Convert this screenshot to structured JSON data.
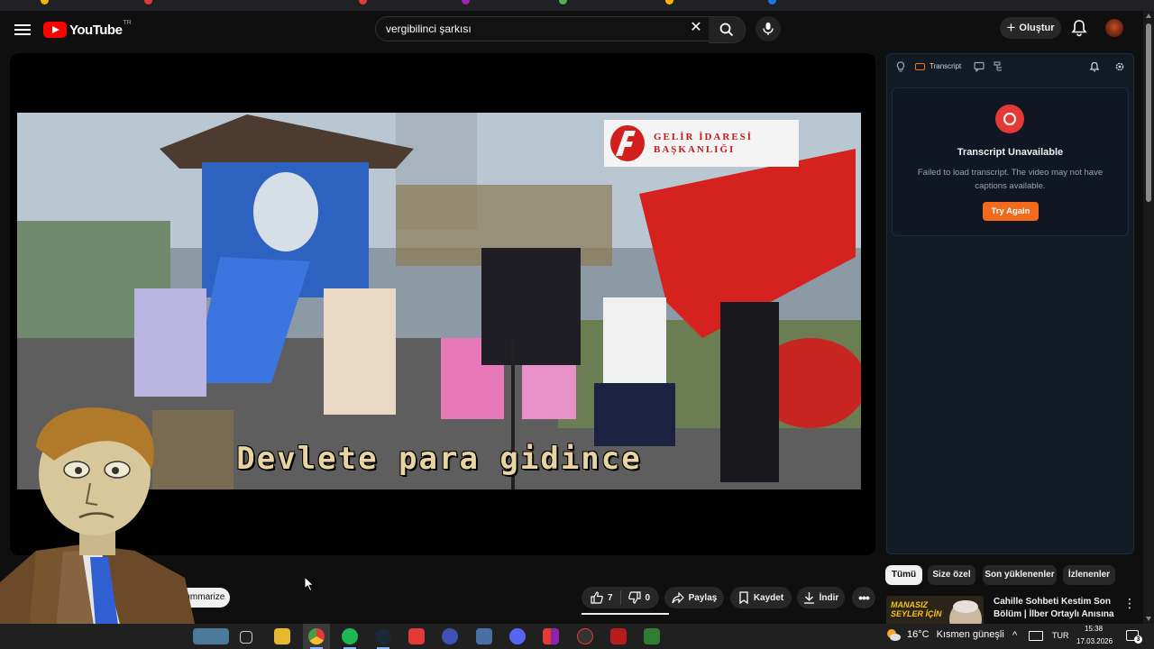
{
  "app": {
    "name": "YouTube",
    "country_code": "TR"
  },
  "search": {
    "value": "vergibilinci şarkısı"
  },
  "header": {
    "create_label": "Oluştur"
  },
  "player": {
    "caption": "Devlete para gidince",
    "watermark_line1": "GELİR İDARESİ",
    "watermark_line2": "BAŞKANLIĞI"
  },
  "panel": {
    "tab_label": "Transcript",
    "error_title": "Transcript Unavailable",
    "error_message": "Failed to load transcript. The video may not have captions available.",
    "retry_label": "Try Again"
  },
  "chips": [
    {
      "label": "Tümü",
      "active": true
    },
    {
      "label": "Size özel",
      "active": false
    },
    {
      "label": "Son yüklenenler",
      "active": false
    },
    {
      "label": "İzlenenler",
      "active": false
    }
  ],
  "recommendation": {
    "title": "Cahille Sohbeti Kestim Son Bölüm | İlber Ortaylı Anısına",
    "thumb_text": "MANASIZ SEYLER İÇİN"
  },
  "actions": {
    "like_count": "7",
    "dislike_count": "0",
    "share_label": "Paylaş",
    "save_label": "Kaydet",
    "download_label": "İndir",
    "summarize_label": "Summarize"
  },
  "taskbar": {
    "weather_temp": "16°C",
    "weather_desc": "Kısmen güneşli",
    "language": "TUR",
    "time": "15:38",
    "date": "17.03.2026",
    "notification_count": "3"
  },
  "colors": {
    "accent": "#f26a1b",
    "youtube_red": "#ff0000",
    "error": "#e53935"
  }
}
